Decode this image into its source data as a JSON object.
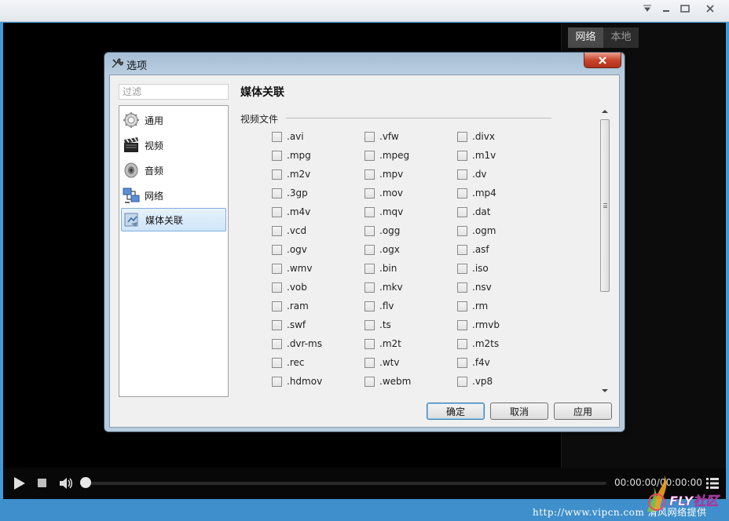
{
  "player": {
    "right_tabs": [
      "网络",
      "本地"
    ],
    "time_text": "00:00:00/00:00:00",
    "footer_url": "http://www.vipcn.com 清风网络提供",
    "brand_text": "FLY社区"
  },
  "dialog": {
    "title": "选项",
    "close_label": "x",
    "filter_placeholder": "过滤",
    "categories": [
      {
        "label": "通用",
        "icon": "gear-icon"
      },
      {
        "label": "视频",
        "icon": "clapperboard-icon"
      },
      {
        "label": "音频",
        "icon": "speaker-icon"
      },
      {
        "label": "网络",
        "icon": "network-icon"
      },
      {
        "label": "媒体关联",
        "icon": "media-association-icon",
        "selected": true
      }
    ],
    "section_title": "媒体关联",
    "group_label": "视频文件",
    "columns": [
      [
        ".avi",
        ".mpg",
        ".m2v",
        ".3gp",
        ".m4v",
        ".vcd",
        ".ogv",
        ".wmv",
        ".vob",
        ".ram",
        ".swf",
        ".dvr-ms",
        ".rec",
        ".hdmov"
      ],
      [
        ".vfw",
        ".mpeg",
        ".mpv",
        ".mov",
        ".mqv",
        ".ogg",
        ".ogx",
        ".bin",
        ".mkv",
        ".flv",
        ".ts",
        ".m2t",
        ".wtv",
        ".webm"
      ],
      [
        ".divx",
        ".m1v",
        ".dv",
        ".mp4",
        ".dat",
        ".ogm",
        ".asf",
        ".iso",
        ".nsv",
        ".rm",
        ".rmvb",
        ".m2ts",
        ".f4v",
        ".vp8"
      ]
    ],
    "buttons": {
      "ok": "确定",
      "cancel": "取消",
      "apply": "应用"
    }
  }
}
